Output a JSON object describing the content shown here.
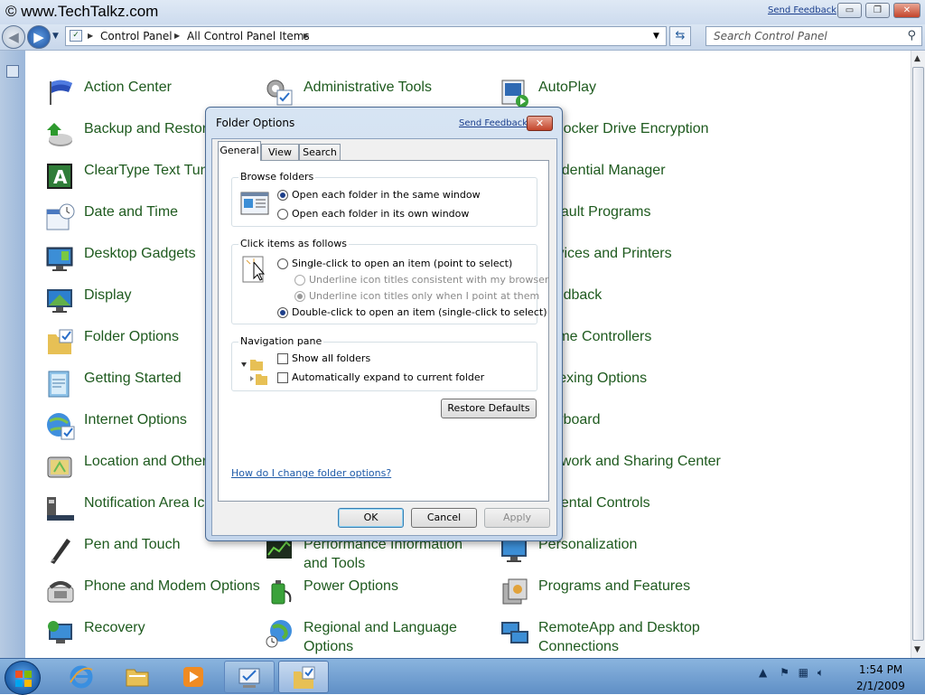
{
  "watermark": "© www.TechTalkz.com",
  "window": {
    "send_feedback": "Send Feedback",
    "minimize": "▭",
    "maximize": "❐",
    "close": "✕"
  },
  "address_bar": {
    "crumbs": [
      "Control Panel",
      "All Control Panel Items"
    ],
    "search_placeholder": "Search Control Panel"
  },
  "control_panel_items": [
    {
      "label": "Action Center",
      "icon": "flag-icon"
    },
    {
      "label": "Backup and Restore",
      "icon": "backup-icon"
    },
    {
      "label": "ClearType Text Tuner",
      "icon": "cleartype-icon"
    },
    {
      "label": "Date and Time",
      "icon": "calendar-clock-icon"
    },
    {
      "label": "Desktop Gadgets",
      "icon": "gadgets-icon"
    },
    {
      "label": "Display",
      "icon": "display-icon"
    },
    {
      "label": "Folder Options",
      "icon": "folder-options-icon"
    },
    {
      "label": "Getting Started",
      "icon": "getting-started-icon"
    },
    {
      "label": "Internet Options",
      "icon": "internet-options-icon"
    },
    {
      "label": "Location and Other Sensors",
      "icon": "sensors-icon"
    },
    {
      "label": "Notification Area Icons",
      "icon": "notification-area-icon"
    },
    {
      "label": "Pen and Touch",
      "icon": "pen-icon"
    },
    {
      "label": "Phone and Modem Options",
      "icon": "phone-icon"
    },
    {
      "label": "Recovery",
      "icon": "recovery-icon"
    },
    {
      "label": "Administrative Tools",
      "icon": "admin-tools-icon"
    },
    {
      "label": "Performance Information and Tools",
      "icon": "performance-icon"
    },
    {
      "label": "Power Options",
      "icon": "power-icon"
    },
    {
      "label": "Regional and Language Options",
      "icon": "globe-icon"
    },
    {
      "label": "AutoPlay",
      "icon": "autoplay-icon"
    },
    {
      "label": "BitLocker Drive Encryption",
      "icon": "bitlocker-icon"
    },
    {
      "label": "Credential Manager",
      "icon": "credential-icon"
    },
    {
      "label": "Default Programs",
      "icon": "default-programs-icon"
    },
    {
      "label": "Devices and Printers",
      "icon": "printer-icon"
    },
    {
      "label": "Feedback",
      "icon": "feedback-icon"
    },
    {
      "label": "Game Controllers",
      "icon": "game-controller-icon"
    },
    {
      "label": "Indexing Options",
      "icon": "indexing-icon"
    },
    {
      "label": "Keyboard",
      "icon": "keyboard-icon"
    },
    {
      "label": "Network and Sharing Center",
      "icon": "network-icon"
    },
    {
      "label": "Parental Controls",
      "icon": "parental-icon"
    },
    {
      "label": "Personalization",
      "icon": "personalization-icon"
    },
    {
      "label": "Programs and Features",
      "icon": "programs-icon"
    },
    {
      "label": "RemoteApp and Desktop Connections",
      "icon": "remoteapp-icon"
    }
  ],
  "dialog": {
    "title": "Folder Options",
    "send_feedback": "Send Feedback",
    "tabs": [
      "General",
      "View",
      "Search"
    ],
    "browse_folders": {
      "label": "Browse folders",
      "options": [
        "Open each folder in the same window",
        "Open each folder in its own window"
      ],
      "selected": 0
    },
    "click_items": {
      "label": "Click items as follows",
      "options": [
        "Single-click to open an item (point to select)",
        "Underline icon titles consistent with my browser",
        "Underline icon titles only when I point at them",
        "Double-click to open an item (single-click to select)"
      ],
      "selected": 3
    },
    "navigation_pane": {
      "label": "Navigation pane",
      "options": [
        "Show all folders",
        "Automatically expand to current folder"
      ]
    },
    "restore_defaults": "Restore Defaults",
    "help_link": "How do I change folder options?",
    "ok": "OK",
    "cancel": "Cancel",
    "apply": "Apply"
  },
  "taskbar": {
    "time": "1:54 PM",
    "date": "2/1/2009"
  }
}
